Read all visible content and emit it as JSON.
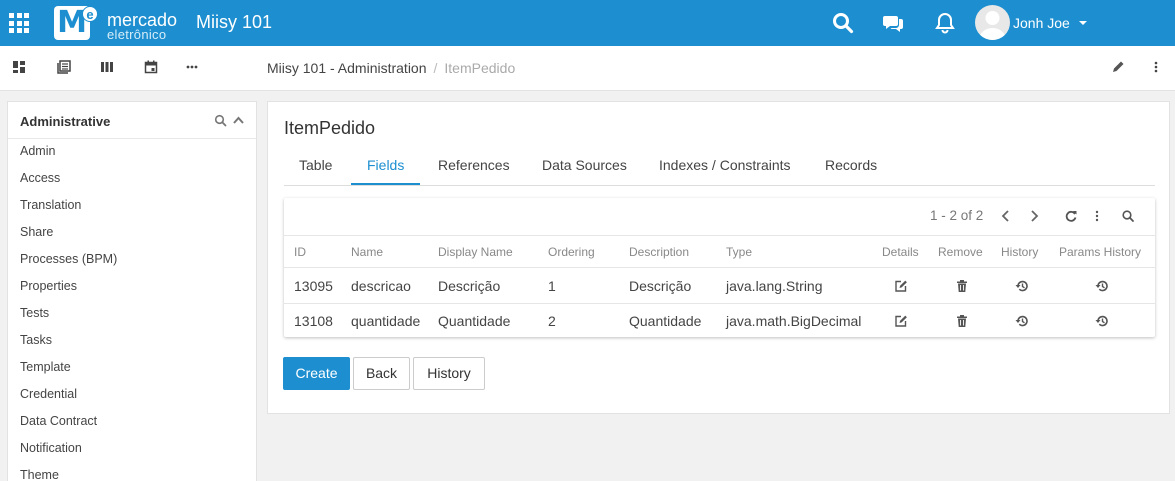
{
  "header": {
    "logo_word1": "mercado",
    "logo_word2": "eletrônico",
    "logo_letter": "M",
    "logo_sup": "e",
    "app_title": "Miisy 101",
    "user_name": "Jonh Joe",
    "icons": [
      "apps-icon",
      "search-icon",
      "chat-icon",
      "bell-icon",
      "avatar",
      "caret-down-icon"
    ]
  },
  "subbar": {
    "icons": [
      "dashboard-icon",
      "list-icon",
      "columns-icon",
      "calendar-icon",
      "more-horizontal-icon",
      "pencil-icon",
      "more-vertical-icon"
    ],
    "breadcrumb": {
      "parent": "Miisy 101 - Administration",
      "separator": "/",
      "current": "ItemPedido"
    }
  },
  "sidebar": {
    "title": "Administrative",
    "items": [
      {
        "label": "Admin"
      },
      {
        "label": "Access"
      },
      {
        "label": "Translation"
      },
      {
        "label": "Share"
      },
      {
        "label": "Processes (BPM)"
      },
      {
        "label": "Properties"
      },
      {
        "label": "Tests"
      },
      {
        "label": "Tasks"
      },
      {
        "label": "Template"
      },
      {
        "label": "Credential"
      },
      {
        "label": "Data Contract"
      },
      {
        "label": "Notification"
      },
      {
        "label": "Theme"
      }
    ]
  },
  "main": {
    "title": "ItemPedido",
    "tabs": [
      {
        "label": "Table"
      },
      {
        "label": "Fields",
        "active": true
      },
      {
        "label": "References"
      },
      {
        "label": "Data Sources"
      },
      {
        "label": "Indexes / Constraints"
      },
      {
        "label": "Records"
      }
    ],
    "grid": {
      "pager": "1 - 2 of 2",
      "columns": [
        "ID",
        "Name",
        "Display Name",
        "Ordering",
        "Description",
        "Type",
        "Details",
        "Remove",
        "History",
        "Params History"
      ],
      "rows": [
        {
          "id": "13095",
          "name": "descricao",
          "display_name": "Descrição",
          "ordering": "1",
          "description": "Descrição",
          "type": "java.lang.String"
        },
        {
          "id": "13108",
          "name": "quantidade",
          "display_name": "Quantidade",
          "ordering": "2",
          "description": "Quantidade",
          "type": "java.math.BigDecimal"
        }
      ]
    },
    "buttons": {
      "create": "Create",
      "back": "Back",
      "history": "History"
    }
  },
  "colors": {
    "brand": "#1d8fd0",
    "background": "#f1f1f1"
  }
}
